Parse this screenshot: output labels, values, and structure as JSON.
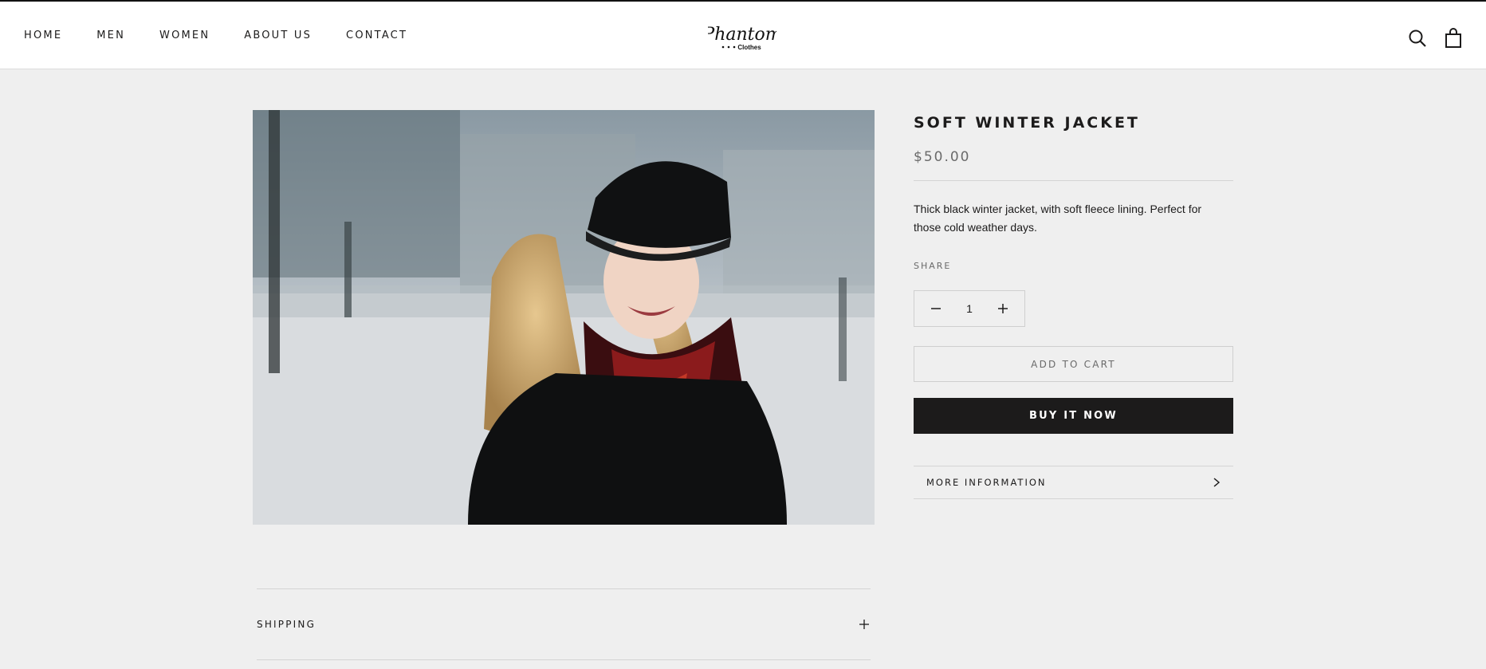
{
  "nav": {
    "items": [
      "HOME",
      "MEN",
      "WOMEN",
      "ABOUT US",
      "CONTACT"
    ]
  },
  "brand": {
    "logo_text": "Phantom",
    "logo_subtext": "Clothes",
    "accent": "#1c1b1b"
  },
  "icons": {
    "search": "search-icon",
    "cart": "shopping-bag-icon"
  },
  "product": {
    "title": "SOFT WINTER JACKET",
    "price": "$50.00",
    "description": "Thick black winter jacket, with soft fleece lining. Perfect for those cold weather days.",
    "share_label": "SHARE",
    "quantity": "1",
    "add_to_cart_label": "ADD TO CART",
    "buy_now_label": "BUY IT NOW",
    "more_info_label": "MORE INFORMATION"
  },
  "accordion": {
    "shipping_label": "SHIPPING"
  },
  "colors": {
    "background": "#efefef",
    "header_bg": "#ffffff",
    "button_dark": "#1c1b1b",
    "muted_text": "#6a6a6a"
  }
}
